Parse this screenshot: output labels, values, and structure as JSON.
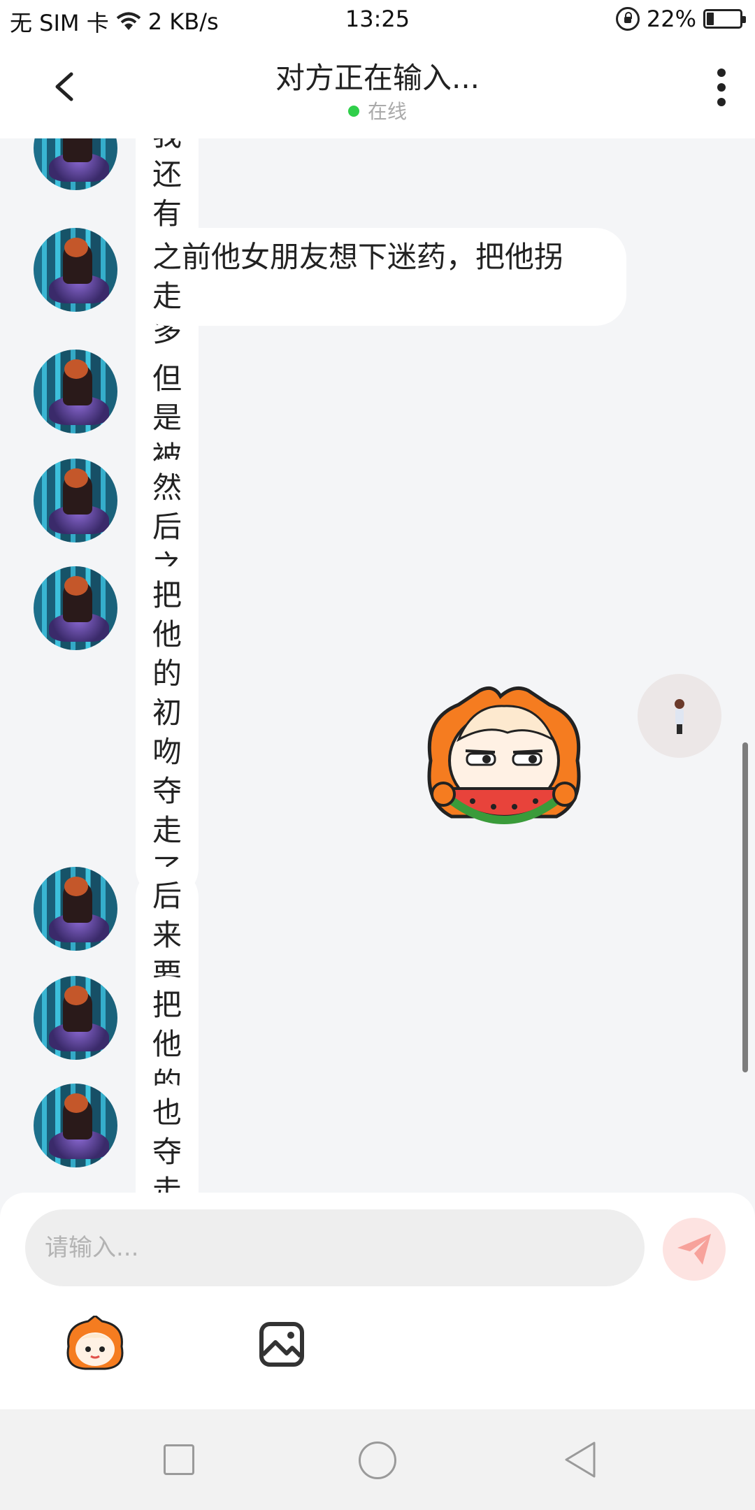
{
  "status_bar": {
    "carrier": "无 SIM 卡",
    "speed": "2 KB/s",
    "time": "13:25",
    "battery": "22%",
    "battery_level": 0.22
  },
  "header": {
    "title": "对方正在输入...",
    "online_status": "在线",
    "back_icon": "chevron-left-icon",
    "more_icon": "more-vertical-icon"
  },
  "messages": [
    {
      "text": "我还有他很多的瓜"
    },
    {
      "text": "之前他女朋友想下迷药，把他拐\n走"
    },
    {
      "text": "但是被他发现了"
    },
    {
      "text": "然后之后又强吻了她"
    },
    {
      "text": "把他的初吻夺走了"
    },
    {
      "text": "后来要给他下了迷药"
    },
    {
      "text": "把他的身子"
    },
    {
      "text": "也夺走了"
    }
  ],
  "sent_sticker": {
    "icon": "watermelon-sticker"
  },
  "input": {
    "placeholder": "请输入..."
  },
  "toolbar": {
    "emoji_icon": "emoji-icon",
    "image_icon": "image-icon",
    "send_icon": "send-icon"
  },
  "colors": {
    "online": "#2fcf4a",
    "send_button": "#fde3e1",
    "send_arrow": "#f7a29b",
    "sticker_orange": "#f57c20"
  }
}
